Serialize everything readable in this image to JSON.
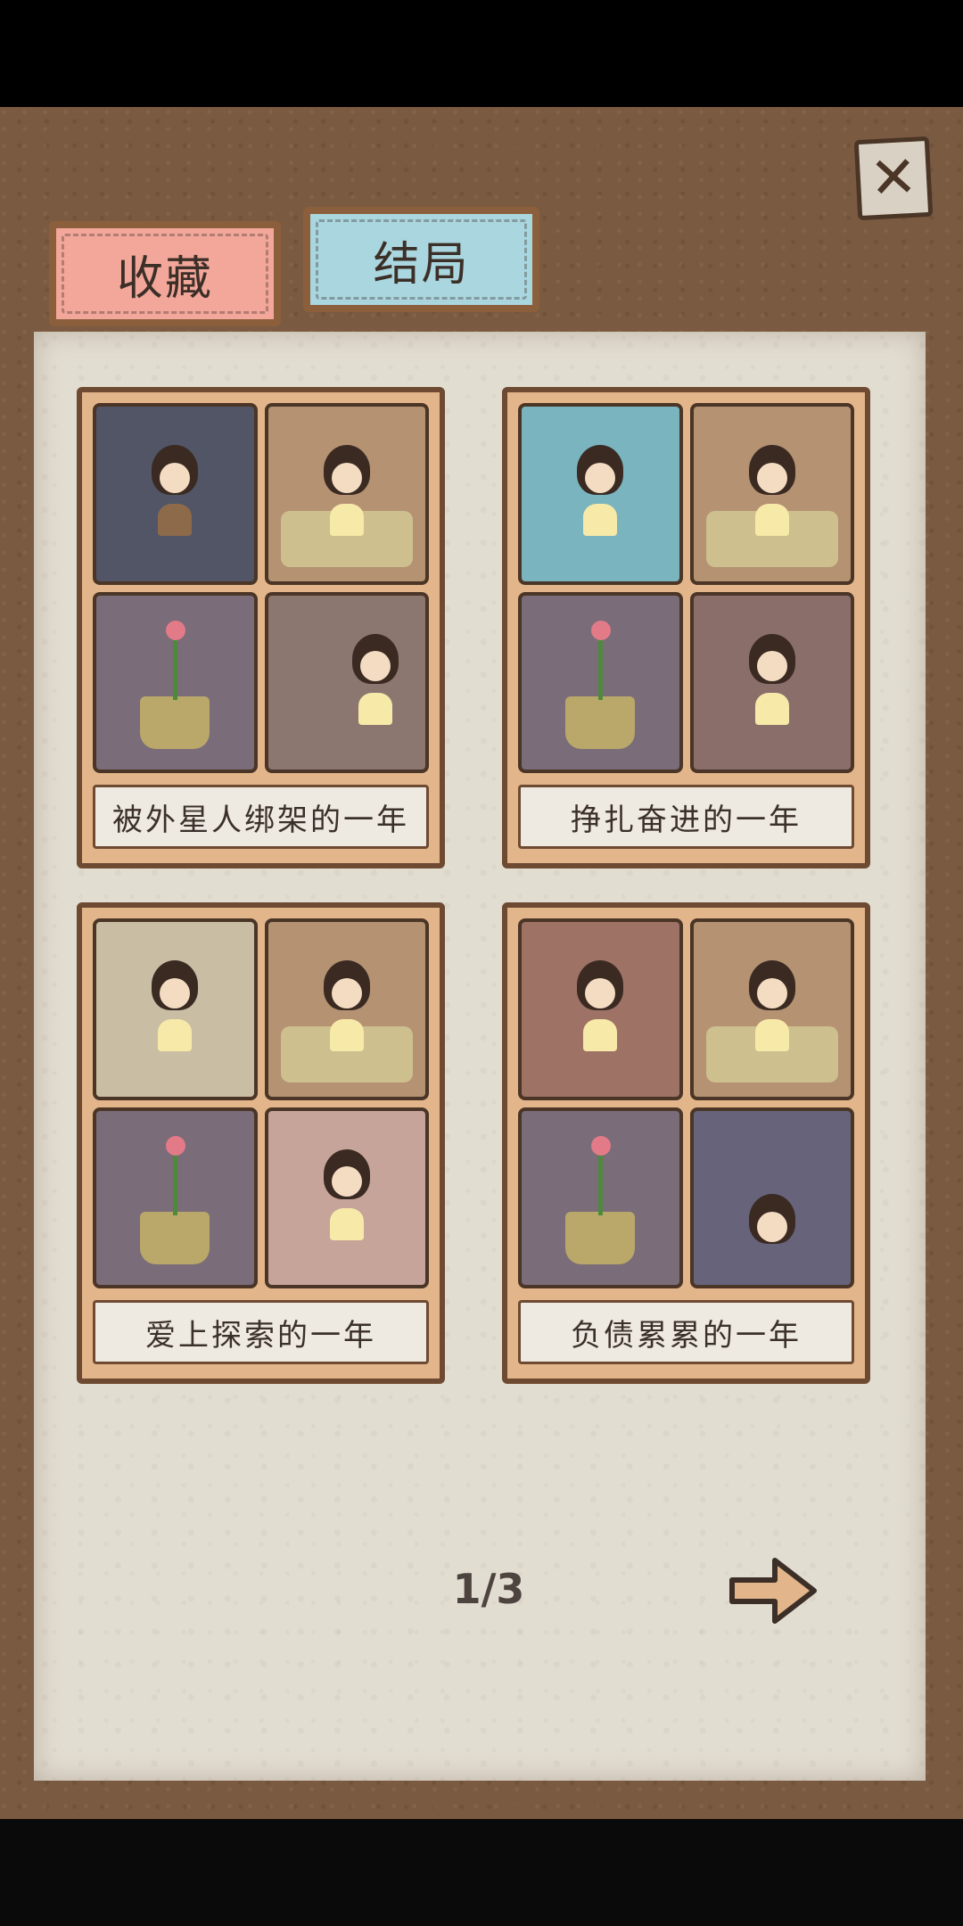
{
  "tabs": [
    {
      "label": "收藏",
      "active": false
    },
    {
      "label": "结局",
      "active": true
    }
  ],
  "close_icon": "close-x-icon",
  "endings": [
    {
      "title": "被外星人绑架的一年"
    },
    {
      "title": "挣扎奋进的一年"
    },
    {
      "title": "爱上探索的一年"
    },
    {
      "title": "负债累累的一年"
    }
  ],
  "pagination": {
    "label": "1/3",
    "next_icon": "arrow-right-icon"
  },
  "colors": {
    "board": "#7a5a40",
    "paper": "#e2ddd1",
    "tab_collect": "#f2a79a",
    "tab_ending": "#a9d6df",
    "card_frame": "#e3b58a",
    "arrow": "#e3b58a"
  }
}
